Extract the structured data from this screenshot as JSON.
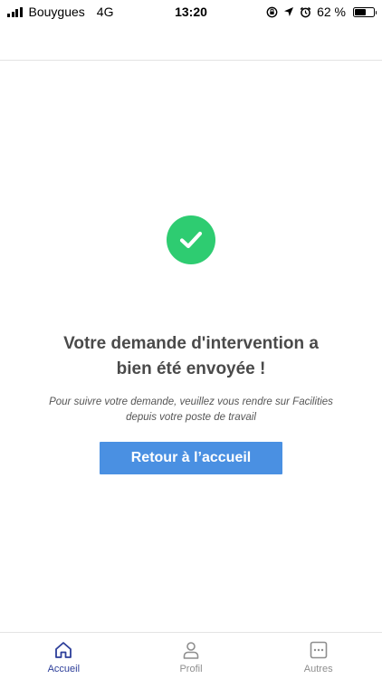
{
  "status_bar": {
    "carrier": "Bouygues",
    "network": "4G",
    "time": "13:20",
    "battery": "62 %",
    "battery_level": 0.62
  },
  "content": {
    "title_line1": "Votre demande d'intervention a",
    "title_line2": "bien été envoyée !",
    "subtitle_line1": "Pour suivre votre demande, veuillez vous rendre sur Facilities",
    "subtitle_line2": "depuis votre poste de travail",
    "button_label": "Retour à l’accueil",
    "success_color": "#2ecc71",
    "button_color": "#4a90e2"
  },
  "tab_bar": {
    "tabs": [
      {
        "label": "Accueil",
        "icon": "home-icon",
        "active": true
      },
      {
        "label": "Profil",
        "icon": "user-icon",
        "active": false
      },
      {
        "label": "Autres",
        "icon": "more-icon",
        "active": false
      }
    ],
    "active_color": "#2c3e99",
    "inactive_color": "#8e8e8e"
  }
}
